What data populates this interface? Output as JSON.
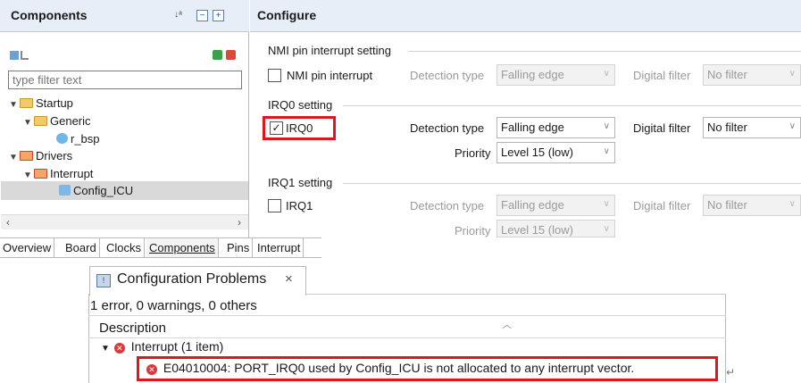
{
  "components": {
    "title": "Components",
    "filter_placeholder": "type filter text",
    "tree": {
      "startup": "Startup",
      "generic": "Generic",
      "r_bsp": "r_bsp",
      "drivers": "Drivers",
      "interrupt": "Interrupt",
      "config_icu": "Config_ICU"
    }
  },
  "configure": {
    "title": "Configure",
    "nmi": {
      "group_title": "NMI pin interrupt setting",
      "checkbox_label": "NMI pin interrupt",
      "checked": false,
      "detection_label": "Detection type",
      "detection_value": "Falling edge",
      "filter_label": "Digital filter",
      "filter_value": "No filter"
    },
    "irq0": {
      "group_title": "IRQ0 setting",
      "checkbox_label": "IRQ0",
      "checked": true,
      "check_mark": "✓",
      "detection_label": "Detection type",
      "detection_value": "Falling edge",
      "filter_label": "Digital filter",
      "filter_value": "No filter",
      "priority_label": "Priority",
      "priority_value": "Level 15 (low)"
    },
    "irq1": {
      "group_title": "IRQ1 setting",
      "checkbox_label": "IRQ1",
      "checked": false,
      "detection_label": "Detection type",
      "detection_value": "Falling edge",
      "filter_label": "Digital filter",
      "filter_value": "No filter",
      "priority_label": "Priority",
      "priority_value": "Level 15 (low)"
    }
  },
  "tabs": [
    "Overview",
    "Board",
    "Clocks",
    "Components",
    "Pins",
    "Interrupt"
  ],
  "problems": {
    "tab_label": "Configuration Problems",
    "close_glyph": "×",
    "summary": "1 error, 0 warnings, 0 others",
    "column_header": "Description",
    "group_label": "Interrupt (1 item)",
    "error_message": "E04010004: PORT_IRQ0 used by Config_ICU is not allocated to any interrupt vector."
  },
  "colors": {
    "highlight": "#e0161e",
    "header_bg": "#e8eef7",
    "error": "#d83a3a"
  }
}
